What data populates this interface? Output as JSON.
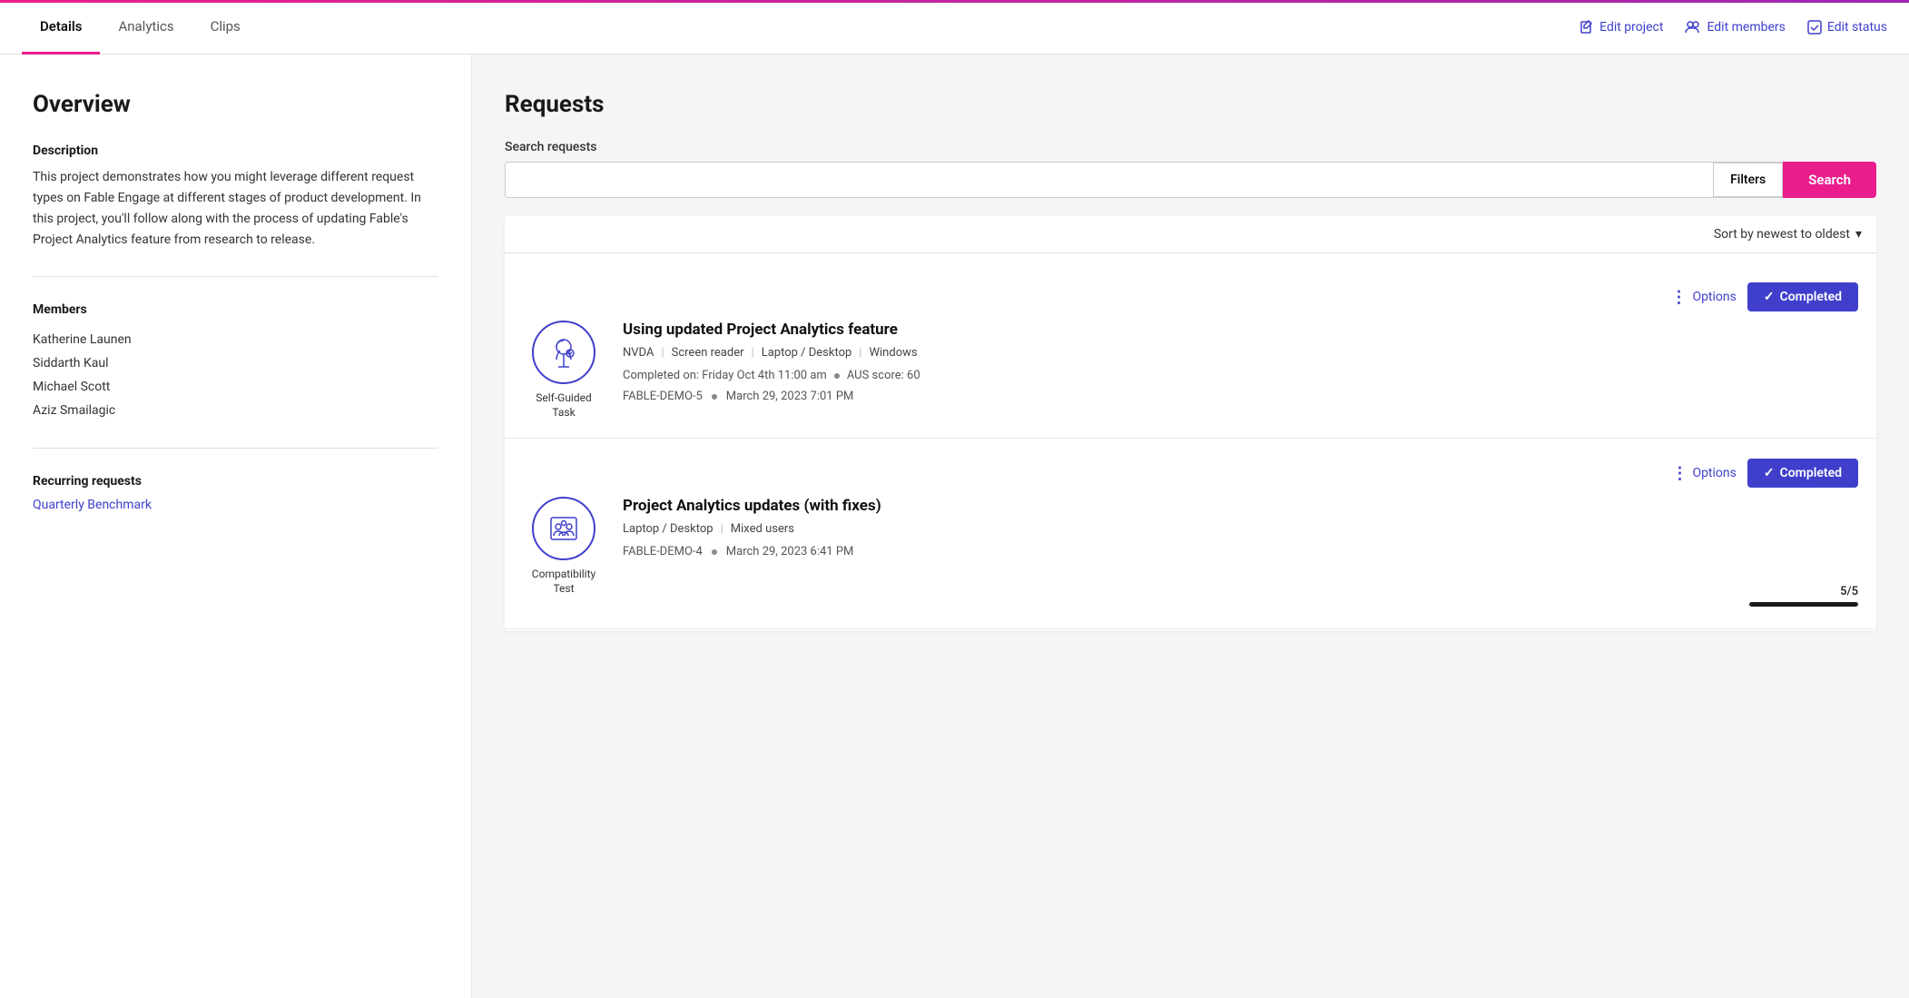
{
  "header": {
    "tabs": [
      {
        "id": "details",
        "label": "Details",
        "active": true
      },
      {
        "id": "analytics",
        "label": "Analytics",
        "active": false
      },
      {
        "id": "clips",
        "label": "Clips",
        "active": false
      }
    ],
    "actions": [
      {
        "id": "edit-project",
        "label": "Edit project",
        "icon": "edit-icon"
      },
      {
        "id": "edit-members",
        "label": "Edit members",
        "icon": "users-icon"
      },
      {
        "id": "edit-status",
        "label": "Edit status",
        "icon": "check-icon"
      }
    ]
  },
  "overview": {
    "title": "Overview",
    "description_label": "Description",
    "description_text": "This project demonstrates how you might leverage different request types on Fable Engage at different stages of product development. In this project, you'll follow along with the process of updating Fable's Project Analytics feature from research to release.",
    "members_label": "Members",
    "members": [
      "Katherine Launen",
      "Siddarth Kaul",
      "Michael Scott",
      "Aziz Smailagic"
    ],
    "recurring_label": "Recurring requests",
    "recurring_link_text": "Quarterly Benchmark"
  },
  "requests": {
    "title": "Requests",
    "search_label": "Search requests",
    "search_placeholder": "",
    "filters_label": "Filters",
    "search_button": "Search",
    "sort_label": "Sort by newest to oldest",
    "cards": [
      {
        "id": "card-1",
        "options_label": "Options",
        "status": "Completed",
        "icon_type": "self-guided",
        "icon_label": "Self-Guided\nTask",
        "title": "Using updated Project Analytics feature",
        "tags": [
          "NVDA",
          "Screen reader",
          "Laptop / Desktop",
          "Windows"
        ],
        "completed_on": "Completed on: Friday Oct 4th 11:00 am",
        "aus_score": "AUS score: 60",
        "ticket": "FABLE-DEMO-5",
        "date": "March 29, 2023 7:01 PM",
        "progress": null
      },
      {
        "id": "card-2",
        "options_label": "Options",
        "status": "Completed",
        "icon_type": "compatibility",
        "icon_label": "Compatibility\nTest",
        "title": "Project Analytics updates (with fixes)",
        "tags": [
          "Laptop / Desktop",
          "Mixed users"
        ],
        "completed_on": null,
        "aus_score": null,
        "ticket": "FABLE-DEMO-4",
        "date": "March 29, 2023 6:41 PM",
        "progress_label": "5/5",
        "progress_pct": 100
      }
    ]
  },
  "icons": {
    "edit": "✏",
    "users": "👥",
    "check": "✓",
    "dots": "⋮",
    "check_small": "✓",
    "chevron_down": "▾"
  }
}
